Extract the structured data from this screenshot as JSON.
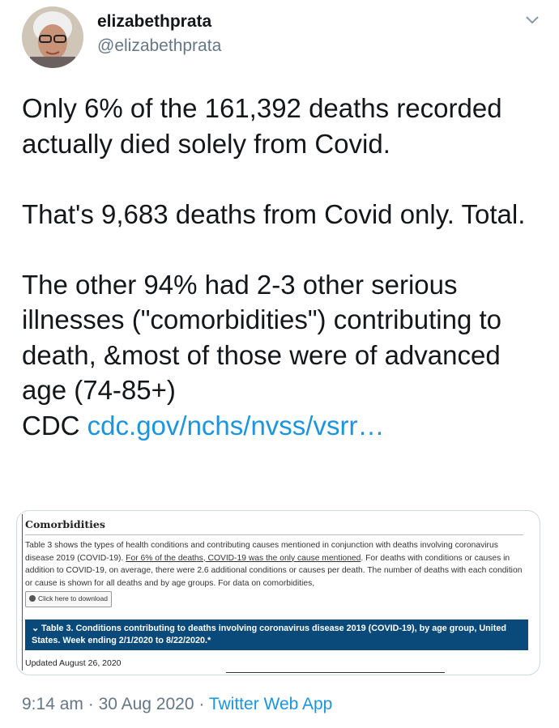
{
  "tweet": {
    "author_name": "elizabethprata",
    "author_handle": "@elizabethprata",
    "text_p1": "Only 6% of the 161,392 deaths recorded actually died solely from Covid.",
    "text_p2": "That's 9,683 deaths from Covid only. Total.",
    "text_p3": "The other 94% had 2-3 other serious illnesses (\"comorbidities\") contributing to death, &most of those were of advanced age (74-85+)",
    "text_prefix_cdc": "CDC",
    "link_text": "cdc.gov/nchs/nvss/vsrr…",
    "time": "9:14 am",
    "date": "30 Aug 2020",
    "source_app": "Twitter Web App",
    "separator": "·"
  },
  "card": {
    "title": "Comorbidities",
    "para_a": "Table 3 shows the types of health conditions and contributing causes mentioned in conjunction with deaths involving coronavirus disease 2019 (COVID-19). ",
    "para_u": "For 6% of the deaths, COVID-19 was the only cause mentioned",
    "para_b": ". For deaths with conditions or causes in addition to COVID-19, on average, there were 2.6 additional conditions or causes per death. The number of deaths with each condition or cause is shown for all deaths and by age groups. For data on comorbidities,",
    "download_label": "Click here to download",
    "table_caret": "⌄",
    "table_title": "Table 3. Conditions contributing to deaths involving coronavirus disease 2019 (COVID-19), by age group, United States. Week ending 2/1/2020 to 8/22/2020.*",
    "updated": "Updated August 26, 2020"
  },
  "colors": {
    "link": "#1b95e0",
    "secondary_text": "#657786",
    "table_bar": "#0a4a7a"
  },
  "icons": {
    "menu": "chevron-down-icon",
    "download": "download-icon"
  }
}
